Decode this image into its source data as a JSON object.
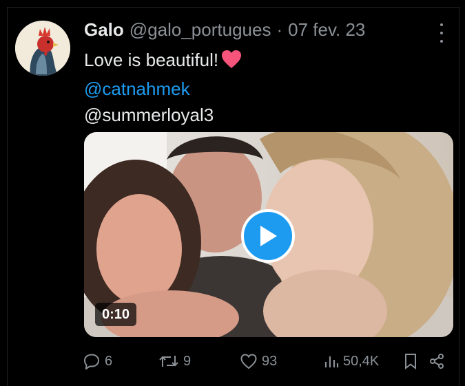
{
  "tweet": {
    "author_name": "Galo",
    "handle": "@galo_portugues",
    "separator": "·",
    "date": "07 fev. 23",
    "text_line1": "Love is beautiful!",
    "mention1": "@catnahmek",
    "mention2": "@summerloyal3",
    "video_duration": "0:10"
  },
  "actions": {
    "replies": "6",
    "retweets": "9",
    "likes": "93",
    "views": "50,4K"
  },
  "icons": [
    "more-icon",
    "heart-emoji-icon",
    "play-icon",
    "reply-icon",
    "retweet-icon",
    "like-icon",
    "views-icon",
    "bookmark-icon",
    "share-icon"
  ],
  "colors": {
    "accent": "#1d9bf0",
    "muted": "#8b9196",
    "text": "#e7e9ea",
    "background": "#000000",
    "heart": "#f6547a"
  }
}
